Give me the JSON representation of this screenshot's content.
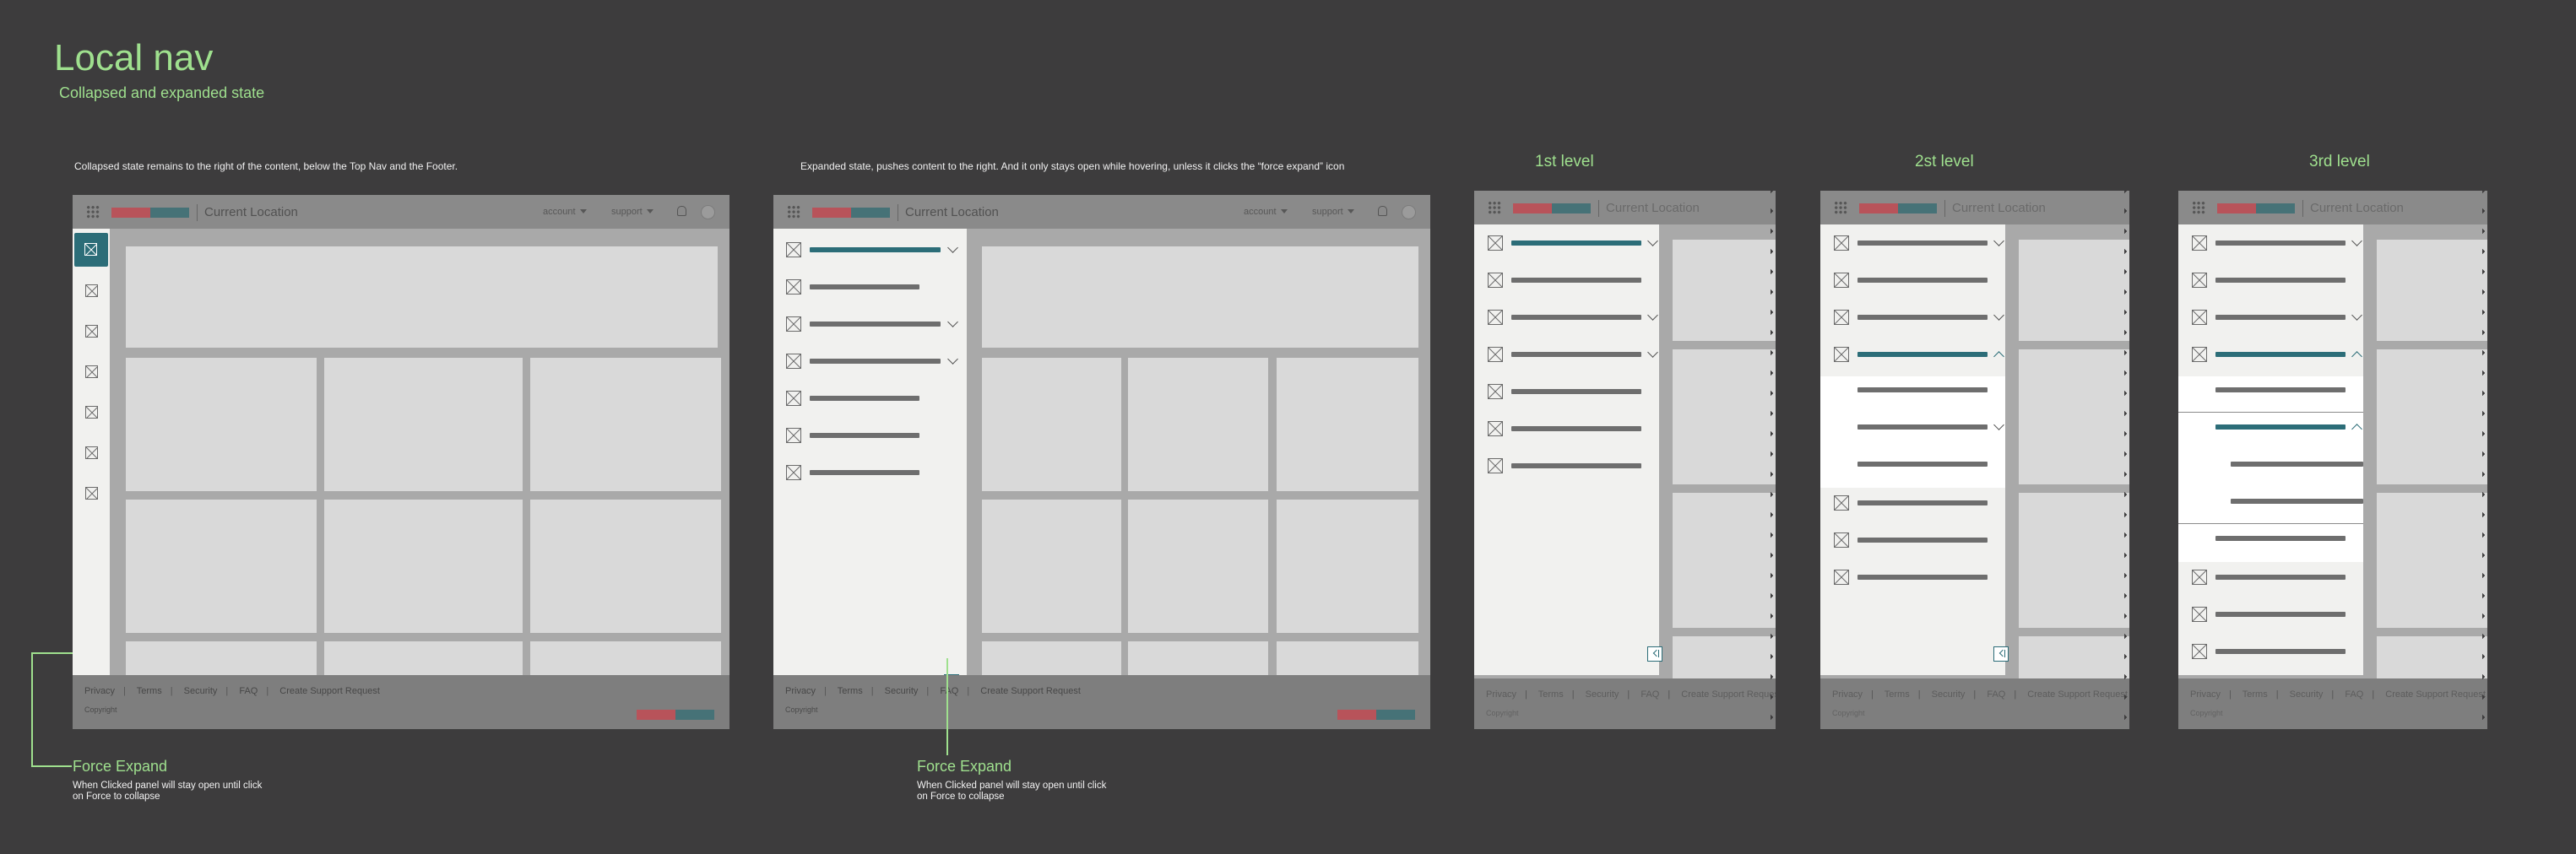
{
  "header": {
    "title": "Local nav",
    "subtitle": "Collapsed and expanded state"
  },
  "descriptions": {
    "collapsed": "Collapsed state remains to the right of the content, below the Top Nav and the Footer.",
    "expanded": "Expanded state, pushes content to the right. And it only stays open while hovering, unless it clicks the “force expand” icon"
  },
  "levels": {
    "first": "1st level",
    "second": "2st level",
    "third": "3rd level"
  },
  "topnav": {
    "location": "Current Location",
    "account": "account",
    "support": "support"
  },
  "footer": {
    "links": [
      "Privacy",
      "Terms",
      "Security",
      "FAQ",
      "Create Support Request"
    ],
    "copyright": "Copyright"
  },
  "annotations": {
    "force_expand_title": "Force Expand",
    "force_expand_desc": "When Clicked panel will stay open until click on Force to collapse"
  },
  "colors": {
    "accent": "#2c6d78",
    "annotation": "#9fe08e",
    "logo_red": "#b8535a"
  },
  "icons": [
    "grid-icon",
    "placeholder-icon",
    "chevron-down-icon",
    "chevron-up-icon",
    "bell-icon",
    "avatar-icon",
    "force-expand-icon",
    "force-collapse-icon"
  ]
}
